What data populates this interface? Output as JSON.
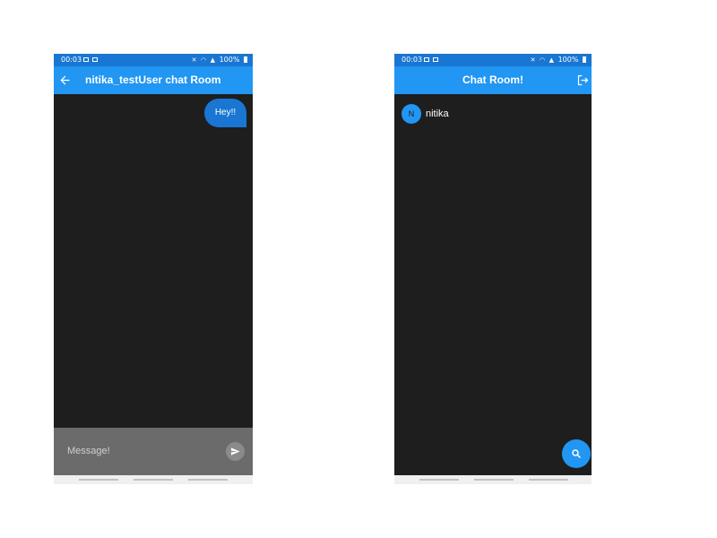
{
  "status_bar": {
    "time": "00:03",
    "battery": "100%",
    "icons": [
      "notification-icon",
      "gallery-icon",
      "mute-icon",
      "wifi-icon",
      "signal-icon",
      "battery-icon"
    ]
  },
  "chat_screen": {
    "title": "nitika_testUser chat Room",
    "back_icon": "arrow-back-icon",
    "messages": [
      {
        "text": "Hey!!",
        "sender": "self"
      }
    ],
    "composer": {
      "placeholder": "Message!",
      "send_icon": "send-icon"
    }
  },
  "rooms_screen": {
    "title": "Chat Room!",
    "logout_icon": "logout-icon",
    "rooms": [
      {
        "avatar_letter": "N",
        "name": "nitika"
      }
    ],
    "fab_icon": "search-icon"
  },
  "colors": {
    "status_bar": "#1976d2",
    "app_bar": "#2196f3",
    "background": "#1e1e1e",
    "sent_bubble": "#1976d2",
    "composer": "#6b6b6b",
    "fab": "#2196f3"
  }
}
